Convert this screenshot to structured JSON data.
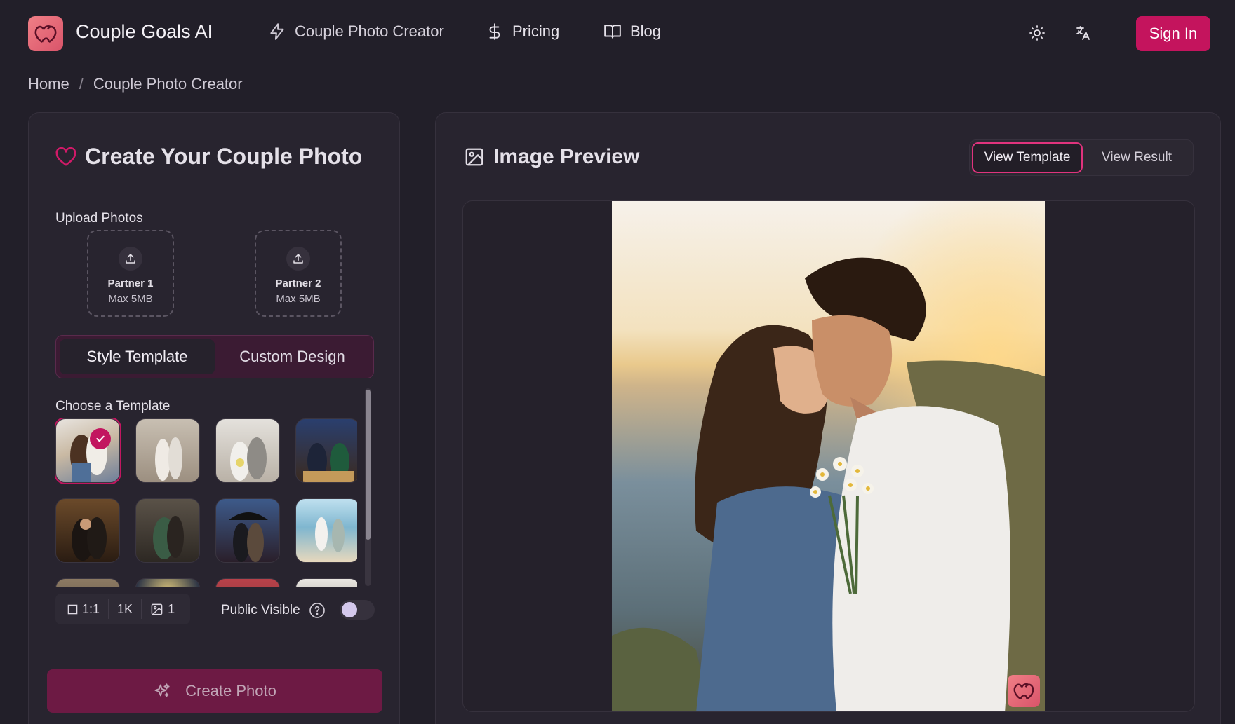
{
  "header": {
    "brand": "Couple Goals AI",
    "nav": {
      "creator": "Couple Photo Creator",
      "pricing": "Pricing",
      "blog": "Blog"
    },
    "sign_in": "Sign In",
    "icons": {
      "creator": "lightning-icon",
      "pricing": "dollar-icon",
      "blog": "book-icon",
      "theme": "sun-icon",
      "language": "translate-icon"
    }
  },
  "breadcrumb": {
    "home": "Home",
    "separator": "/",
    "current": "Couple Photo Creator"
  },
  "creator_panel": {
    "title": "Create Your Couple Photo",
    "upload_label": "Upload Photos",
    "uploads": [
      {
        "name": "Partner 1",
        "limit": "Max 5MB"
      },
      {
        "name": "Partner 2",
        "limit": "Max 5MB"
      }
    ],
    "tabs": [
      {
        "label": "Style Template",
        "active": true
      },
      {
        "label": "Custom Design",
        "active": false
      }
    ],
    "template_label": "Choose a Template",
    "selected_template_index": 0,
    "settings": {
      "aspect_ratio": "1:1",
      "resolution": "1K",
      "image_count": "1"
    },
    "public_label": "Public Visible",
    "public_enabled": false,
    "create_button": "Create Photo"
  },
  "preview_panel": {
    "title": "Image Preview",
    "view_options": [
      {
        "label": "View Template",
        "active": true
      },
      {
        "label": "View Result",
        "active": false
      }
    ]
  },
  "colors": {
    "accent": "#c4145d",
    "background": "#221f29",
    "panel": "#28242f"
  }
}
